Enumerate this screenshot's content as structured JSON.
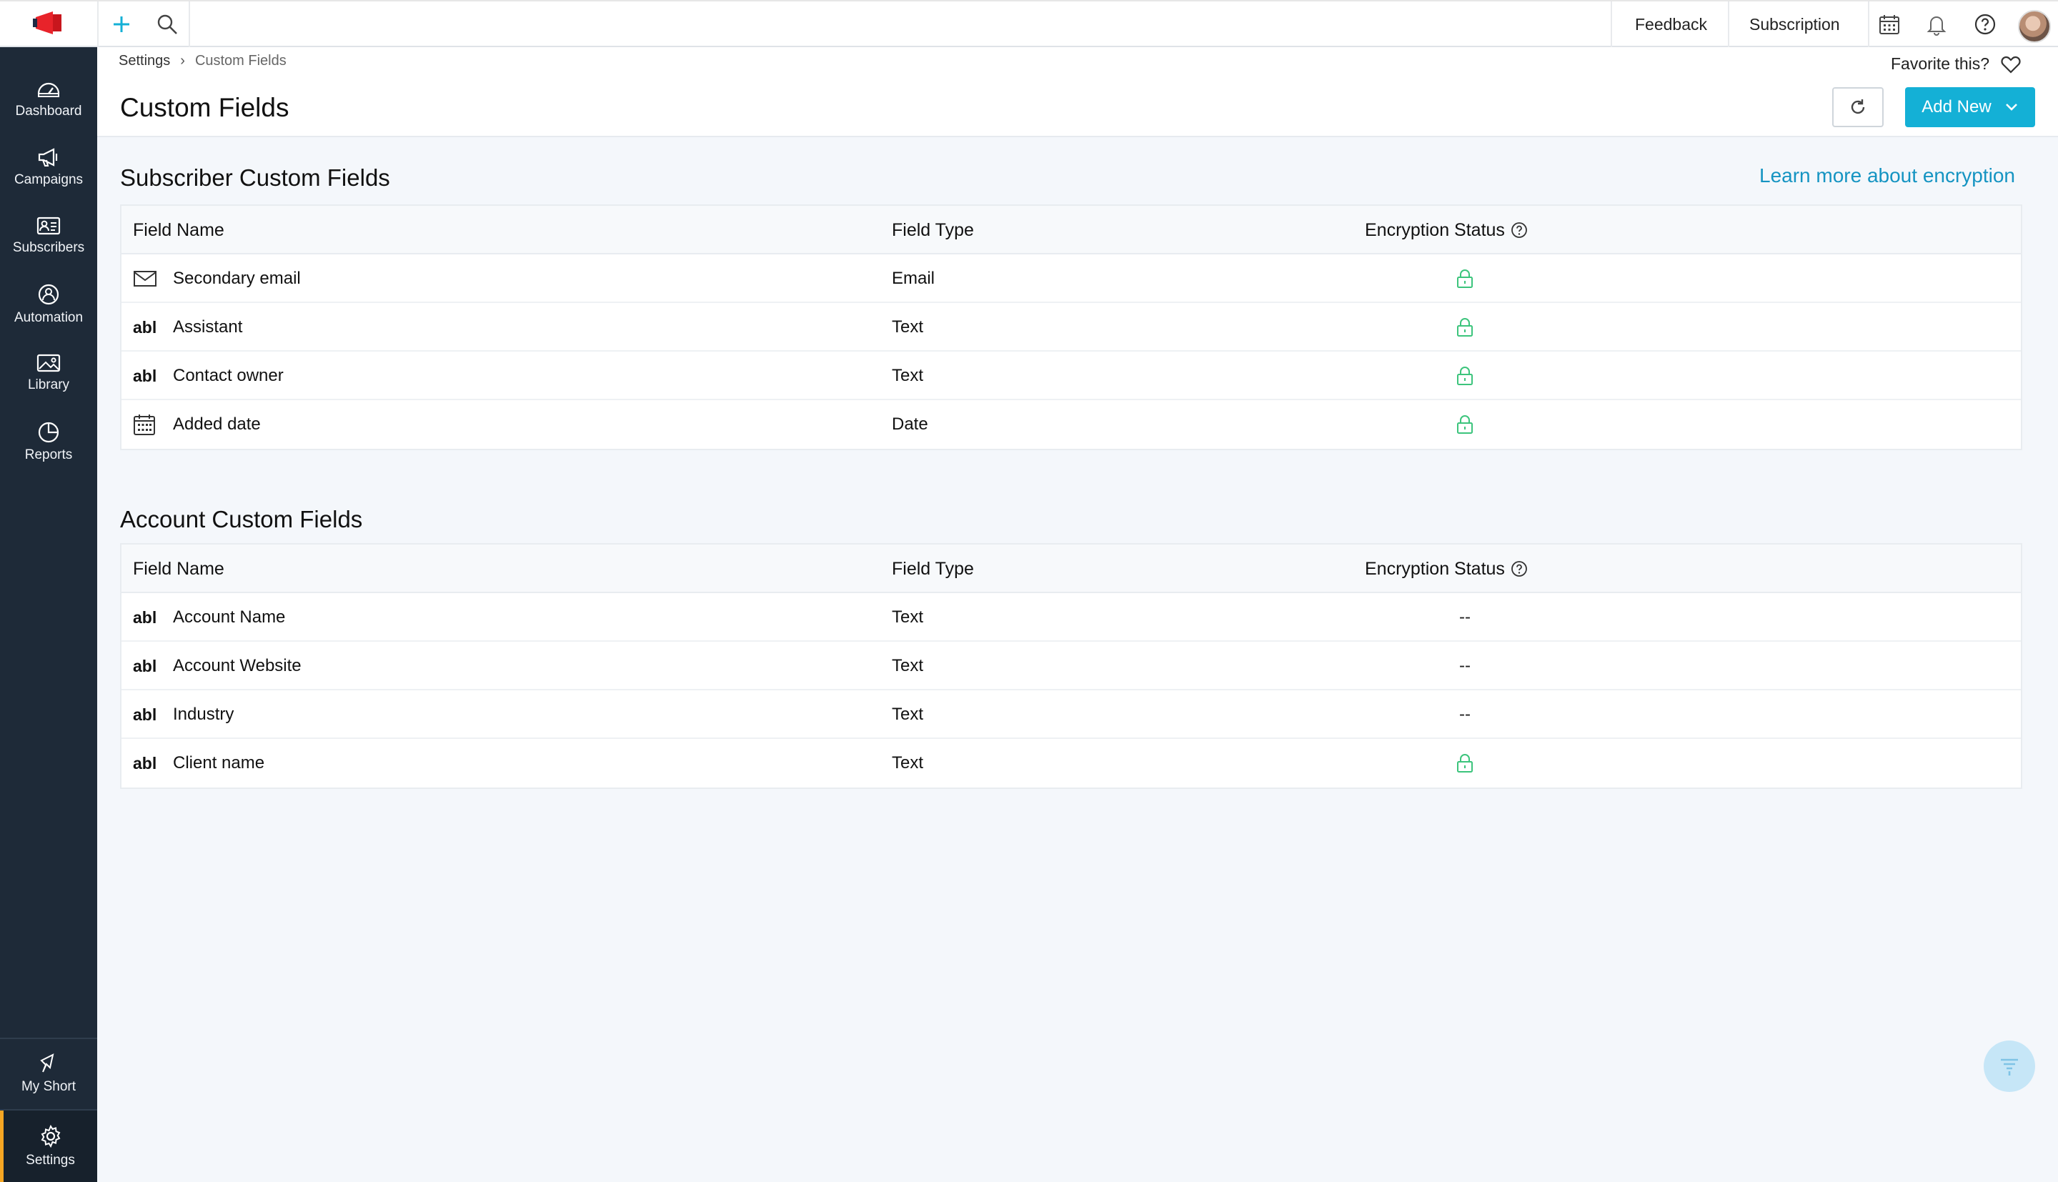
{
  "topbar": {
    "feedback_label": "Feedback",
    "subscription_label": "Subscription",
    "icons": [
      "megaphone-logo-icon",
      "plus-icon",
      "search-icon",
      "calendar-icon",
      "bell-icon",
      "help-icon",
      "avatar"
    ]
  },
  "sidebar": {
    "items": [
      {
        "label": "Dashboard",
        "icon": "dashboard-icon"
      },
      {
        "label": "Campaigns",
        "icon": "megaphone-icon"
      },
      {
        "label": "Subscribers",
        "icon": "subscribers-icon"
      },
      {
        "label": "Automation",
        "icon": "automation-icon"
      },
      {
        "label": "Library",
        "icon": "image-icon"
      },
      {
        "label": "Reports",
        "icon": "pie-chart-icon"
      }
    ],
    "bottom_items": [
      {
        "label": "My Short",
        "icon": "shortcut-icon"
      },
      {
        "label": "Settings",
        "icon": "gear-icon",
        "active": true
      }
    ]
  },
  "breadcrumb": {
    "parent": "Settings",
    "current": "Custom Fields"
  },
  "header": {
    "title": "Custom Fields",
    "favorite_label": "Favorite this?",
    "add_new_label": "Add New"
  },
  "subscriber_section": {
    "title": "Subscriber Custom Fields",
    "learn_more": "Learn more about encryption",
    "columns": [
      "Field Name",
      "Field Type",
      "Encryption Status"
    ],
    "rows": [
      {
        "icon": "email",
        "name": "Secondary email",
        "type": "Email",
        "encrypted": true
      },
      {
        "icon": "abl",
        "name": "Assistant",
        "type": "Text",
        "encrypted": true
      },
      {
        "icon": "abl",
        "name": "Contact owner",
        "type": "Text",
        "encrypted": true
      },
      {
        "icon": "date",
        "name": "Added date",
        "type": "Date",
        "encrypted": true
      }
    ]
  },
  "account_section": {
    "title": "Account Custom Fields",
    "columns": [
      "Field Name",
      "Field Type",
      "Encryption Status"
    ],
    "rows": [
      {
        "icon": "abl",
        "name": "Account Name",
        "type": "Text",
        "encryption": "--"
      },
      {
        "icon": "abl",
        "name": "Account Website",
        "type": "Text",
        "encryption": "--"
      },
      {
        "icon": "abl",
        "name": "Industry",
        "type": "Text",
        "encryption": "--"
      },
      {
        "icon": "abl",
        "name": "Client name",
        "type": "Text",
        "encrypted": true
      }
    ]
  },
  "field_icon_text": "abl",
  "colors": {
    "accent": "#14b0d6",
    "sidebar": "#1e2a38",
    "lock": "#3cc47c",
    "active_marker": "#f5a623",
    "link": "#1594c2"
  }
}
